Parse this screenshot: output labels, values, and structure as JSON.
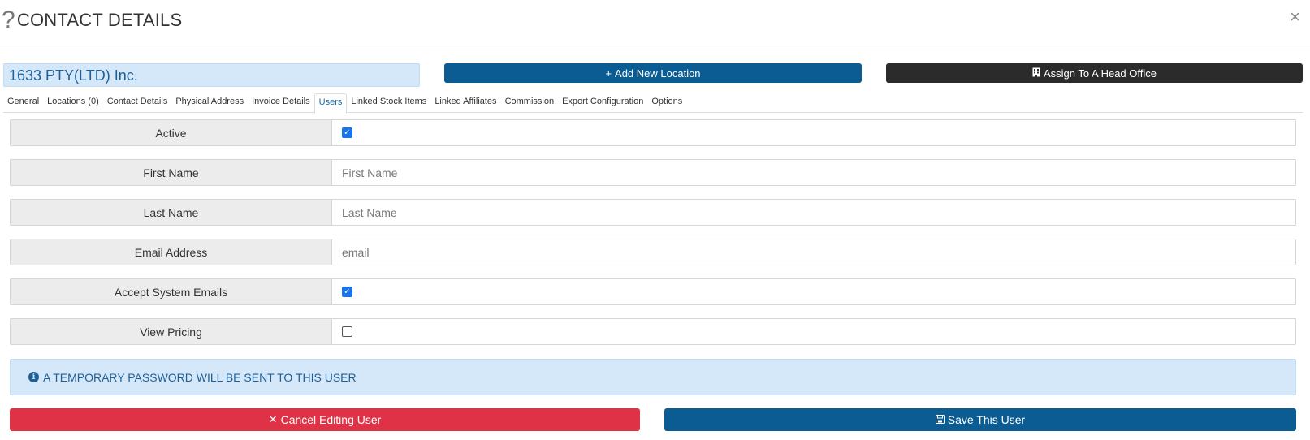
{
  "modal": {
    "title": "CONTACT DETAILS",
    "title_icon": "?",
    "close_icon": "×"
  },
  "company": {
    "name": "1633 PTY(LTD) Inc."
  },
  "actions": {
    "add_location_icon": "+",
    "add_location_label": "Add New Location",
    "assign_head_office_icon": "▮",
    "assign_head_office_label": "Assign To A Head Office"
  },
  "tabs": [
    {
      "label": "General"
    },
    {
      "label": "Locations (0)"
    },
    {
      "label": "Contact Details"
    },
    {
      "label": "Physical Address"
    },
    {
      "label": "Invoice Details"
    },
    {
      "label": "Users",
      "active": true
    },
    {
      "label": "Linked Stock Items"
    },
    {
      "label": "Linked Affiliates"
    },
    {
      "label": "Commission"
    },
    {
      "label": "Export Configuration"
    },
    {
      "label": "Options"
    }
  ],
  "form": {
    "active": {
      "label": "Active",
      "checked": true,
      "check_glyph": "✓"
    },
    "first_name": {
      "label": "First Name",
      "value": "",
      "placeholder": "First Name"
    },
    "last_name": {
      "label": "Last Name",
      "value": "",
      "placeholder": "Last Name"
    },
    "email": {
      "label": "Email Address",
      "value": "",
      "placeholder": "email"
    },
    "accept_emails": {
      "label": "Accept System Emails",
      "checked": true,
      "check_glyph": "✓"
    },
    "view_pricing": {
      "label": "View Pricing",
      "checked": false
    }
  },
  "alert": {
    "icon": "i",
    "text": "A TEMPORARY PASSWORD WILL BE SENT TO THIS USER"
  },
  "footer": {
    "cancel_icon": "✕",
    "cancel_label": "Cancel Editing User",
    "save_icon": "🖫",
    "save_label": "Save This User"
  },
  "colors": {
    "primary": "#0a5c92",
    "dark": "#2b2b2b",
    "danger": "#e03246",
    "info_bg": "#d5e8fa",
    "info_text": "#1f5f95"
  }
}
